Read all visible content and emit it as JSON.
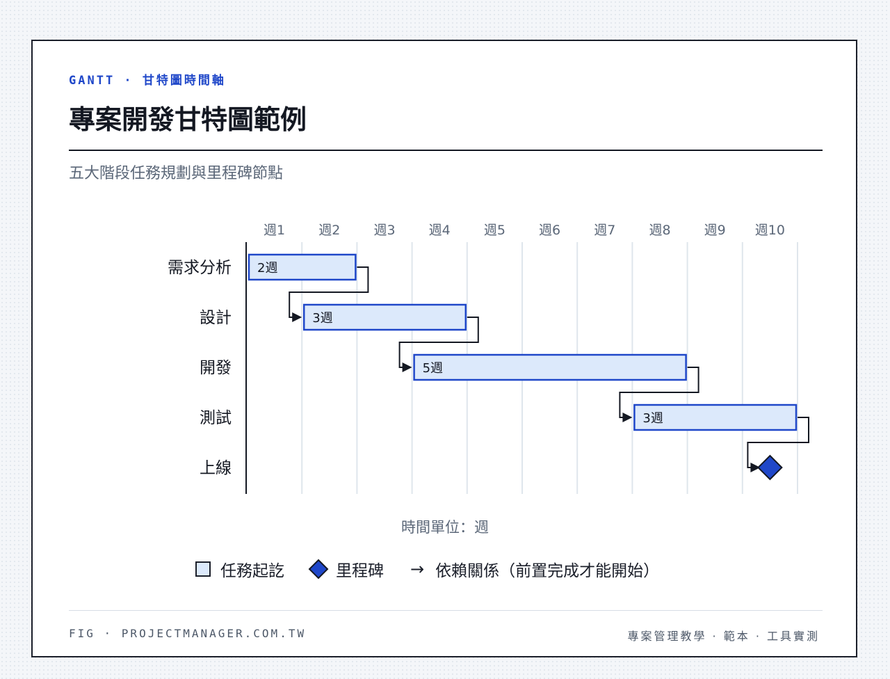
{
  "header": {
    "eyebrow": "GANTT · 甘特圖時間軸",
    "title": "專案開發甘特圖範例",
    "subtitle": "五大階段任務規劃與里程碑節點"
  },
  "colors": {
    "bar_fill": "#dce9fb",
    "bar_stroke": "#1f47c9",
    "milestone": "#1f47c9",
    "grid": "#dfe6ec",
    "ink": "#141822"
  },
  "chart_data": {
    "type": "gantt",
    "x_axis": {
      "label": "時間單位：週",
      "ticks": [
        "週1",
        "週2",
        "週3",
        "週4",
        "週5",
        "週6",
        "週7",
        "週8",
        "週9",
        "週10"
      ],
      "range": [
        1,
        11
      ]
    },
    "tasks": [
      {
        "name": "需求分析",
        "start": 1,
        "duration": 2,
        "label": "2週",
        "kind": "task"
      },
      {
        "name": "設計",
        "start": 2,
        "duration": 3,
        "label": "3週",
        "kind": "task"
      },
      {
        "name": "開發",
        "start": 4,
        "duration": 5,
        "label": "5週",
        "kind": "task"
      },
      {
        "name": "測試",
        "start": 8,
        "duration": 3,
        "label": "3週",
        "kind": "task"
      },
      {
        "name": "上線",
        "start": 10.5,
        "duration": 0,
        "label": "",
        "kind": "milestone"
      }
    ],
    "dependencies": [
      [
        0,
        1
      ],
      [
        1,
        2
      ],
      [
        2,
        3
      ],
      [
        3,
        4
      ]
    ]
  },
  "legend": {
    "task": "任務起訖",
    "milestone": "里程碑",
    "arrow": "→",
    "dependency": "依賴關係（前置完成才能開始）"
  },
  "footer": {
    "left": "FIG · PROJECTMANAGER.COM.TW",
    "right": "專案管理教學 · 範本 · 工具實測"
  }
}
